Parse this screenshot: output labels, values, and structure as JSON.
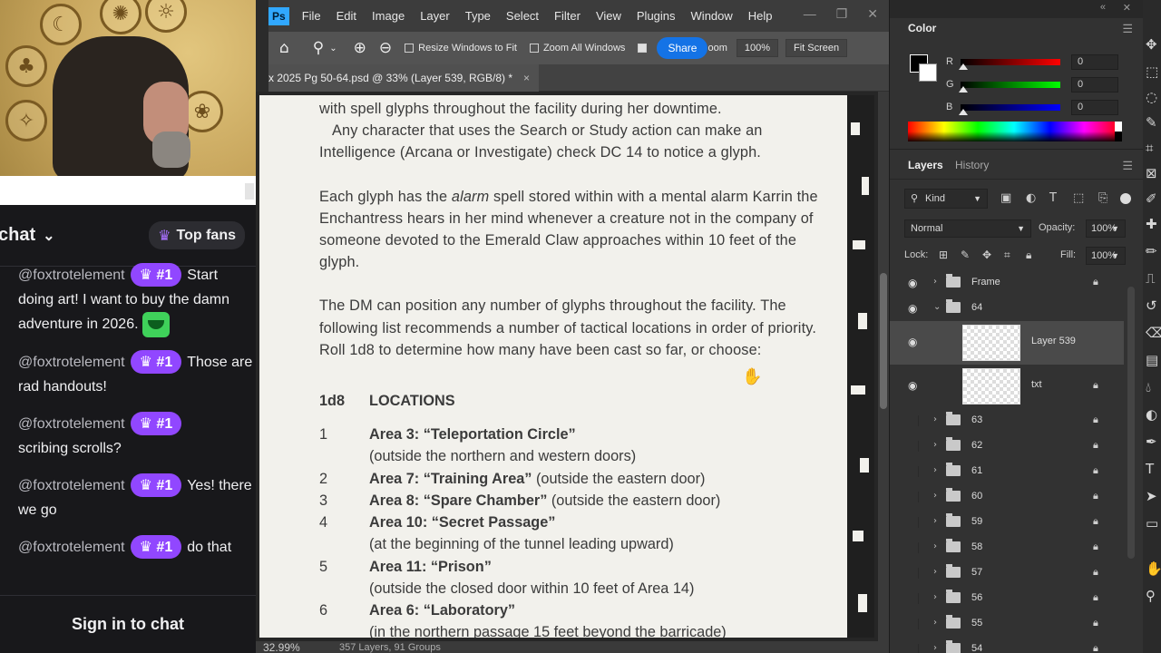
{
  "stream": {
    "webcam": {
      "medallion_icons": [
        "☾",
        "✺",
        "☼",
        "♣",
        "✧",
        "❀"
      ]
    },
    "chat": {
      "title": "chat",
      "title_chevron": "⌄",
      "top_fans_label": "Top fans",
      "messages": [
        {
          "user": "@foxtrotelement",
          "badge": "#1",
          "text": "Start doing art! I want to buy the damn adventure in 2026.",
          "emote": true
        },
        {
          "user": "@foxtrotelement",
          "badge": "#1",
          "text": "Those are rad handouts!"
        },
        {
          "user": "@foxtrotelement",
          "badge": "#1",
          "text": "scribing scrolls?"
        },
        {
          "user": "@foxtrotelement",
          "badge": "#1",
          "text": "Yes! there we go"
        },
        {
          "user": "@foxtrotelement",
          "badge": "#1",
          "text": "do that"
        }
      ],
      "sign_in_label": "Sign in to chat"
    }
  },
  "photoshop": {
    "menu": [
      "File",
      "Edit",
      "Image",
      "Layer",
      "Type",
      "Select",
      "Filter",
      "View",
      "Plugins",
      "Window",
      "Help"
    ],
    "logo": "Ps",
    "options_bar": {
      "resize_windows_label": "Resize Windows to Fit",
      "zoom_all_label": "Zoom All Windows",
      "share_label": "Share",
      "scrubby_label": "oom",
      "zoom_value": "100%",
      "fit_screen_label": "Fit Screen"
    },
    "doc_tab": {
      "title": "x 2025 Pg 50-64.psd @ 33% (Layer 539, RGB/8) *",
      "close": "×"
    },
    "document": {
      "paragraphs": [
        "with spell glyphs throughout the facility during her downtime.",
        "Any character that uses the Search or Study action can make an Intelligence (Arcana or Investigate) check DC 14 to notice a glyph.",
        "Each glyph has the alarm spell stored within with a mental alarm Karrin the Enchantress hears in her mind whenever a creature not in the company of someone devoted to the Emerald Claw approaches within 10 feet of the glyph.",
        "The DM can position any number of glyphs throughout the facility. The following list recommends a number of tactical locations in order of priority. Roll 1d8 to determine how many have been cast so far, or choose:"
      ],
      "para3_lead": "Each glyph has the ",
      "para3_italic": "alarm",
      "para3_rest": " spell stored within with a mental alarm Karrin the Enchantress hears in her mind whenever a creature not in the company of someone devoted to the Emerald Claw approaches within 10 feet of the glyph.",
      "table_headers": [
        "1d8",
        "LOCATIONS"
      ],
      "locations": [
        {
          "num": "1",
          "name": "Area 3: “Teleportation Circle”",
          "note": "(outside the northern and western doors)",
          "inline": false
        },
        {
          "num": "2",
          "name": "Area 7: “Training Area”",
          "note": " (outside the eastern door)",
          "inline": true
        },
        {
          "num": "3",
          "name": "Area 8: “Spare Chamber”",
          "note": " (outside the eastern door)",
          "inline": true
        },
        {
          "num": "4",
          "name": "Area 10: “Secret Passage”",
          "note": "(at the beginning of the tunnel leading upward)",
          "inline": false
        },
        {
          "num": "5",
          "name": "Area 11: “Prison”",
          "note": "(outside the closed door within 10 feet of Area 14)",
          "inline": false
        },
        {
          "num": "6",
          "name": "Area 6: “Laboratory”",
          "note": "(in the northern passage 15 feet beyond the barricade)",
          "inline": false
        }
      ]
    },
    "status": {
      "zoom": "32.99%",
      "info": "357 Layers, 91 Groups"
    },
    "color_panel": {
      "title": "Color",
      "channels": [
        {
          "label": "R",
          "value": "0",
          "gradient": "linear-gradient(to right,#000,#ff0000)"
        },
        {
          "label": "G",
          "value": "0",
          "gradient": "linear-gradient(to right,#000,#00ff00)"
        },
        {
          "label": "B",
          "value": "0",
          "gradient": "linear-gradient(to right,#000,#0000ff)"
        }
      ],
      "foreground": "#000000",
      "background": "#ffffff"
    },
    "layers_panel": {
      "tab_active": "Layers",
      "tab_inactive": "History",
      "kind_label": "Kind",
      "blend_mode": "Normal",
      "opacity_label": "Opacity:",
      "opacity_value": "100%",
      "lock_label": "Lock:",
      "fill_label": "Fill:",
      "fill_value": "100%",
      "layers": [
        {
          "name": "Frame",
          "type": "group",
          "visible": true,
          "expanded": false,
          "locked": true
        },
        {
          "name": "64",
          "type": "group",
          "visible": true,
          "expanded": true,
          "locked": false
        },
        {
          "name": "Layer 539",
          "type": "pixel",
          "visible": true,
          "selected": true,
          "locked": false
        },
        {
          "name": "txt",
          "type": "pixel",
          "visible": true,
          "locked": true
        },
        {
          "name": "63",
          "type": "group",
          "visible": false,
          "expanded": false,
          "locked": true
        },
        {
          "name": "62",
          "type": "group",
          "visible": false,
          "expanded": false,
          "locked": true
        },
        {
          "name": "61",
          "type": "group",
          "visible": false,
          "expanded": false,
          "locked": true
        },
        {
          "name": "60",
          "type": "group",
          "visible": false,
          "expanded": false,
          "locked": true
        },
        {
          "name": "59",
          "type": "group",
          "visible": false,
          "expanded": false,
          "locked": true
        },
        {
          "name": "58",
          "type": "group",
          "visible": false,
          "expanded": false,
          "locked": true
        },
        {
          "name": "57",
          "type": "group",
          "visible": false,
          "expanded": false,
          "locked": true
        },
        {
          "name": "56",
          "type": "group",
          "visible": false,
          "expanded": false,
          "locked": true
        },
        {
          "name": "55",
          "type": "group",
          "visible": false,
          "expanded": false,
          "locked": true
        },
        {
          "name": "54",
          "type": "group",
          "visible": false,
          "expanded": false,
          "locked": true
        }
      ]
    }
  }
}
